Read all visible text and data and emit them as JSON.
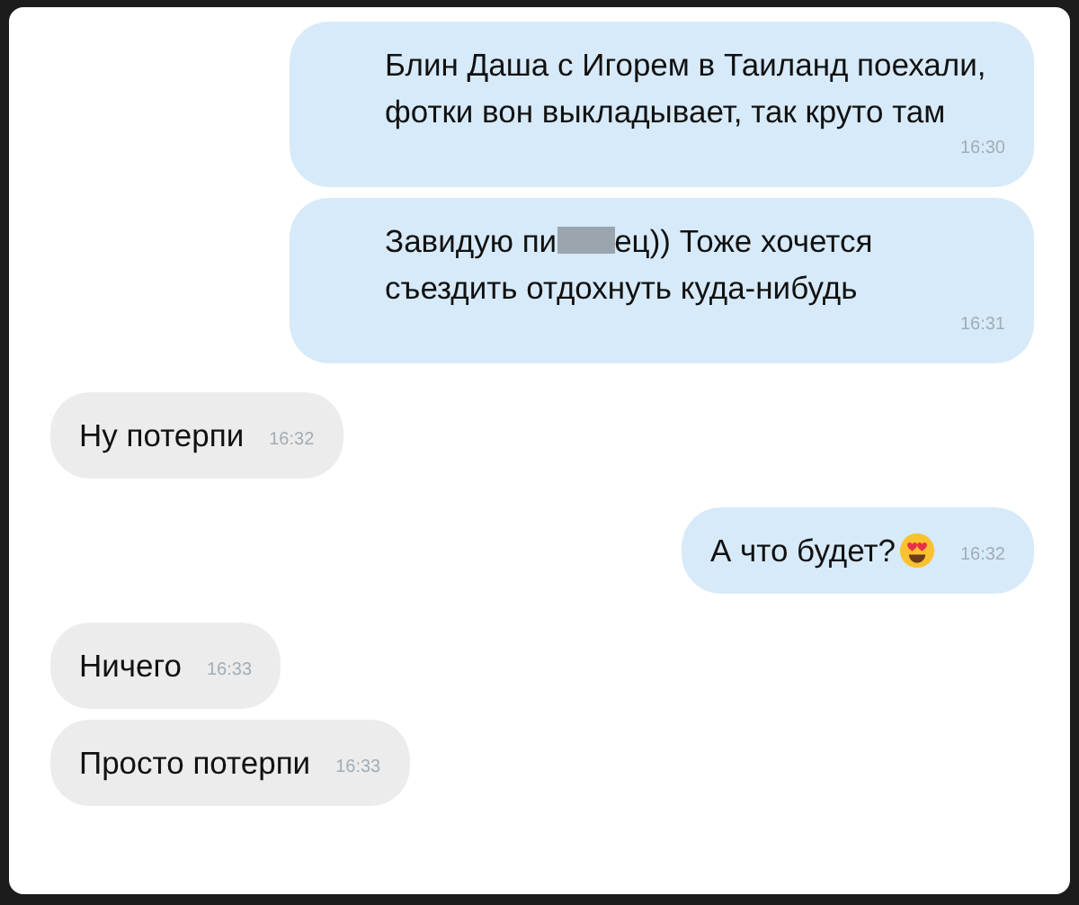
{
  "messages": [
    {
      "kind": "sent",
      "segments": [
        {
          "kind": "text",
          "text": "Блин Даша с Игорем в Таиланд поехали, фотки вон выкладывает, так круто там"
        }
      ],
      "time": "16:30"
    },
    {
      "kind": "sent",
      "segments": [
        {
          "kind": "text",
          "text": "Завидую пи"
        },
        {
          "kind": "censored"
        },
        {
          "kind": "text",
          "text": "ец)) Тоже хочется съездить отдохнуть куда-нибудь"
        }
      ],
      "time": "16:31"
    },
    {
      "kind": "received",
      "segments": [
        {
          "kind": "text",
          "text": "Ну потерпи"
        }
      ],
      "time": "16:32"
    },
    {
      "kind": "sent",
      "segments": [
        {
          "kind": "text",
          "text": "А что будет?"
        },
        {
          "kind": "emoji"
        }
      ],
      "time": "16:32"
    },
    {
      "kind": "received",
      "segments": [
        {
          "kind": "text",
          "text": "Ничего"
        }
      ],
      "time": "16:33"
    },
    {
      "kind": "received",
      "segments": [
        {
          "kind": "text",
          "text": "Просто потерпи"
        }
      ],
      "time": "16:33"
    }
  ]
}
